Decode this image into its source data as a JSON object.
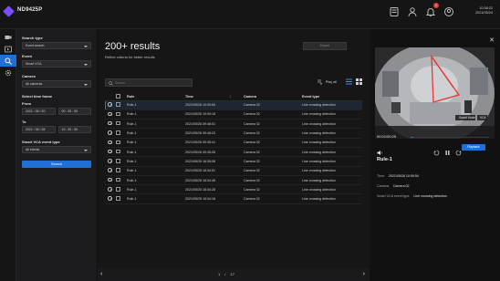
{
  "app": {
    "title": "ND9425P",
    "clock_time": "10:38:22",
    "clock_date": "2021/05/24",
    "notification_count": "1"
  },
  "rail": [
    "live-view",
    "playback",
    "search",
    "settings"
  ],
  "filters": {
    "search_type_label": "Search type",
    "search_type_value": "Event search",
    "event_label": "Event",
    "event_value": "Smart VCA",
    "camera_label": "Camera",
    "camera_value": "All cameras",
    "time_frame_label": "Select time frame",
    "from_label": "From",
    "from_date": "2021 / 05 / 20",
    "from_time": "00 : 30 : 00",
    "to_label": "To",
    "to_date": "2021 / 05 / 26",
    "to_time": "10 : 30 : 00",
    "vca_type_label": "Smart VCA event type",
    "vca_type_value": "All events",
    "search_button": "Search"
  },
  "results": {
    "title": "200+ results",
    "subtitle": "Refine criteria for better results",
    "export_label": "Export",
    "play_all_label": "Play all",
    "search_placeholder": "Search",
    "columns": [
      "Rule",
      "Time",
      "Camera",
      "Event type"
    ],
    "rows": [
      [
        "Rule-1",
        "2021/05/26 10:09:54",
        "Camera 02",
        "Line crossing detection"
      ],
      [
        "Rule-1",
        "2021/05/26 10:09:18",
        "Camera 02",
        "Line crossing detection"
      ],
      [
        "Rule-1",
        "2021/05/26 09:48:51",
        "Camera 02",
        "Line crossing detection"
      ],
      [
        "Rule-1",
        "2021/05/26 09:48:23",
        "Camera 02",
        "Line crossing detection"
      ],
      [
        "Rule-1",
        "2021/05/26 09:35:41",
        "Camera 02",
        "Line crossing detection"
      ],
      [
        "Rule-1",
        "2021/05/26 09:35:26",
        "Camera 02",
        "Line crossing detection"
      ],
      [
        "Rule-1",
        "2021/05/25 18:35:08",
        "Camera 02",
        "Line crossing detection"
      ],
      [
        "Rule-1",
        "2021/05/25 18:34:51",
        "Camera 02",
        "Line crossing detection"
      ],
      [
        "Rule-1",
        "2021/05/25 18:34:45",
        "Camera 02",
        "Line crossing detection"
      ],
      [
        "Rule-1",
        "2021/05/25 18:34:28",
        "Camera 02",
        "Line crossing detection"
      ],
      [
        "Rule-1",
        "2021/05/25 18:34:18",
        "Camera 02",
        "Line crossing detection"
      ]
    ],
    "page_current": "1",
    "page_sep": "/",
    "page_total": "17"
  },
  "detail": {
    "video_time": "00:01/00:25",
    "video_tag_1": "Saved Mode",
    "video_tag_2": "VCA",
    "playback_button": "Playback",
    "title": "Rule-1",
    "time_label": "Time:",
    "time_value": "2021/05/26 10:09:54",
    "camera_label": "Camera:",
    "camera_value": "Camera 02",
    "event_label": "Smart VCA event type:",
    "event_value": "Line crossing detection",
    "video_progress": 0.04
  },
  "colors": {
    "accent": "#1f6fd6",
    "brand": "#7a4dff",
    "detection": "#e53935"
  }
}
